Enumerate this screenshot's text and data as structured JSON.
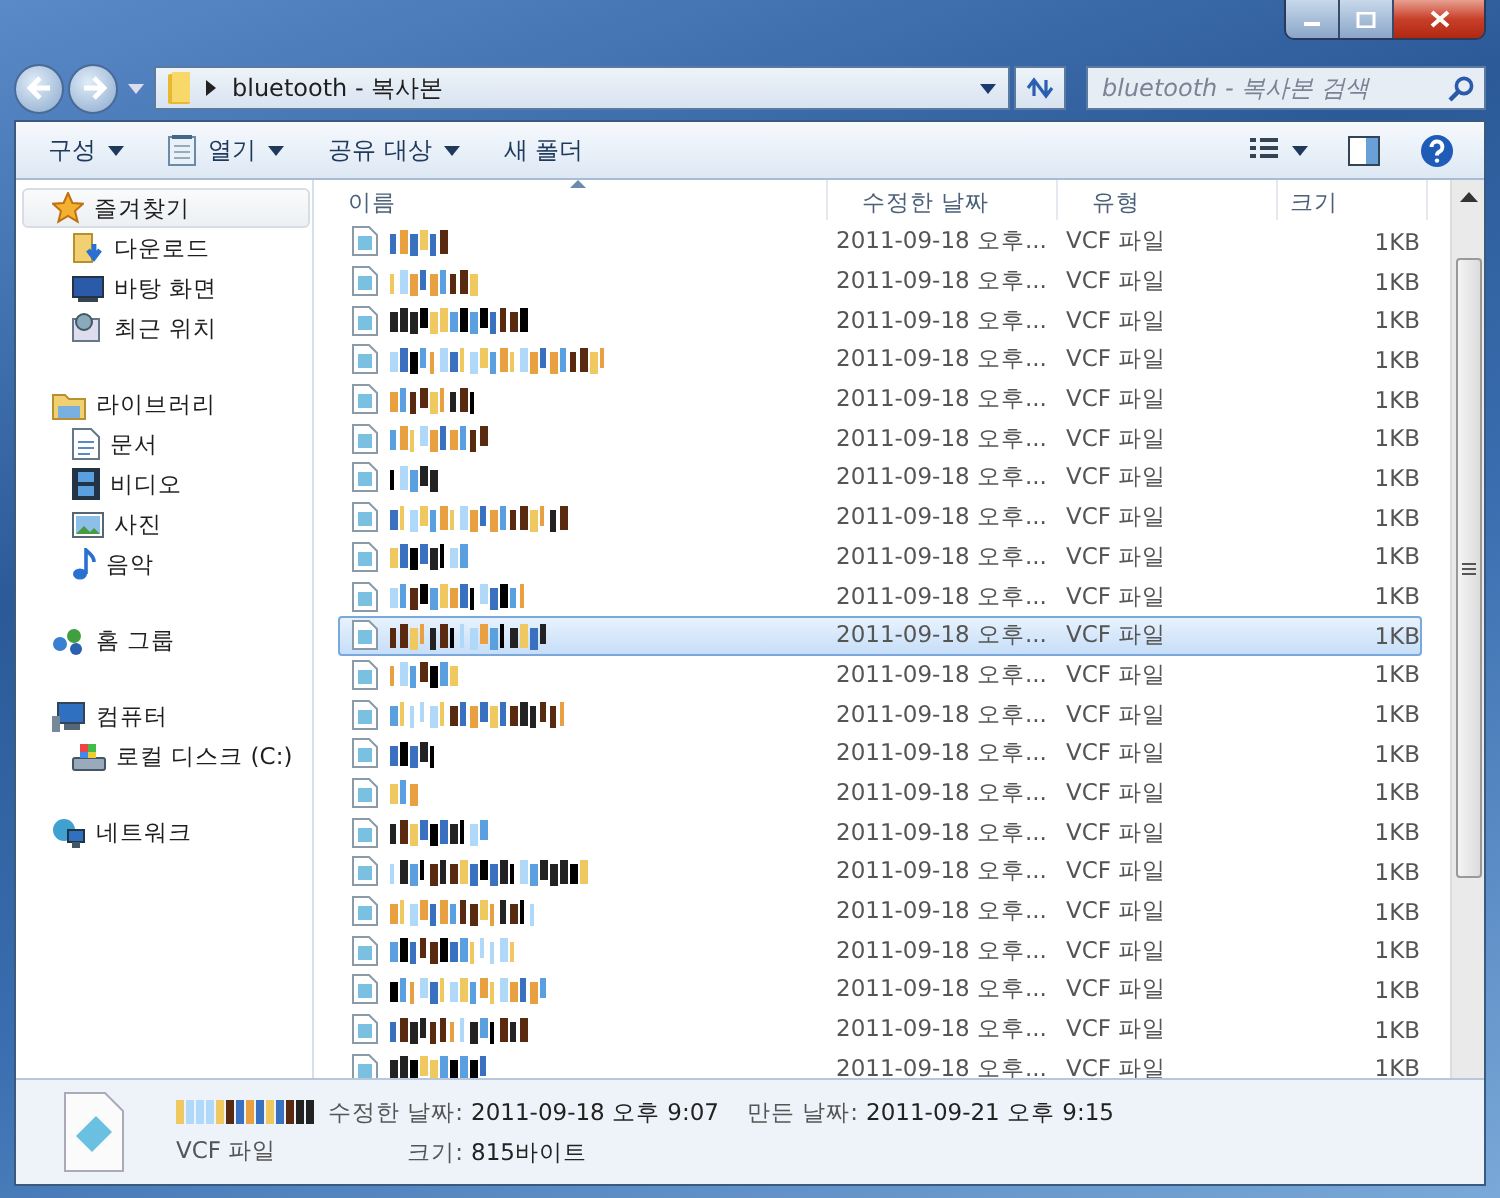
{
  "address": {
    "path": "bluetooth - 복사본"
  },
  "search": {
    "placeholder": "bluetooth - 복사본 검색"
  },
  "toolbar": [
    {
      "label": "구성",
      "dropdown": true
    },
    {
      "label": "열기",
      "dropdown": true
    },
    {
      "label": "공유 대상",
      "dropdown": true
    },
    {
      "label": "새 폴더",
      "dropdown": false
    }
  ],
  "sidebar": {
    "groups": [
      {
        "label": "즐겨찾기",
        "selected": true,
        "children": [
          {
            "label": "다운로드",
            "selected": false
          },
          {
            "label": "바탕 화면",
            "selected": false
          },
          {
            "label": "최근 위치",
            "selected": false
          }
        ]
      },
      {
        "label": "라이브러리",
        "selected": false,
        "children": [
          {
            "label": "문서",
            "selected": false
          },
          {
            "label": "비디오",
            "selected": false
          },
          {
            "label": "사진",
            "selected": false
          },
          {
            "label": "음악",
            "selected": false
          }
        ]
      },
      {
        "label": "홈 그룹",
        "selected": false
      },
      {
        "label": "컴퓨터",
        "selected": false,
        "children": [
          {
            "label": "로컬 디스크 (C:)",
            "selected": false
          }
        ]
      },
      {
        "label": "네트워크",
        "selected": false
      }
    ]
  },
  "columns": [
    {
      "label": "이름",
      "sorted": true
    },
    {
      "label": "수정한 날짜",
      "sorted": false
    },
    {
      "label": "유형",
      "sorted": false
    },
    {
      "label": "크기",
      "sorted": false
    }
  ],
  "rows": [
    {
      "modified": "2011-09-18 오후...",
      "type": "VCF 파일",
      "size": "1KB",
      "selected": false
    },
    {
      "modified": "2011-09-18 오후...",
      "type": "VCF 파일",
      "size": "1KB",
      "selected": false
    },
    {
      "modified": "2011-09-18 오후...",
      "type": "VCF 파일",
      "size": "1KB",
      "selected": false
    },
    {
      "modified": "2011-09-18 오후...",
      "type": "VCF 파일",
      "size": "1KB",
      "selected": false
    },
    {
      "modified": "2011-09-18 오후...",
      "type": "VCF 파일",
      "size": "1KB",
      "selected": false
    },
    {
      "modified": "2011-09-18 오후...",
      "type": "VCF 파일",
      "size": "1KB",
      "selected": false
    },
    {
      "modified": "2011-09-18 오후...",
      "type": "VCF 파일",
      "size": "1KB",
      "selected": false
    },
    {
      "modified": "2011-09-18 오후...",
      "type": "VCF 파일",
      "size": "1KB",
      "selected": false
    },
    {
      "modified": "2011-09-18 오후...",
      "type": "VCF 파일",
      "size": "1KB",
      "selected": false
    },
    {
      "modified": "2011-09-18 오후...",
      "type": "VCF 파일",
      "size": "1KB",
      "selected": false
    },
    {
      "modified": "2011-09-18 오후...",
      "type": "VCF 파일",
      "size": "1KB",
      "selected": true
    },
    {
      "modified": "2011-09-18 오후...",
      "type": "VCF 파일",
      "size": "1KB",
      "selected": false
    },
    {
      "modified": "2011-09-18 오후...",
      "type": "VCF 파일",
      "size": "1KB",
      "selected": false
    },
    {
      "modified": "2011-09-18 오후...",
      "type": "VCF 파일",
      "size": "1KB",
      "selected": false
    },
    {
      "modified": "2011-09-18 오후...",
      "type": "VCF 파일",
      "size": "1KB",
      "selected": false
    },
    {
      "modified": "2011-09-18 오후...",
      "type": "VCF 파일",
      "size": "1KB",
      "selected": false
    },
    {
      "modified": "2011-09-18 오후...",
      "type": "VCF 파일",
      "size": "1KB",
      "selected": false
    },
    {
      "modified": "2011-09-18 오후...",
      "type": "VCF 파일",
      "size": "1KB",
      "selected": false
    },
    {
      "modified": "2011-09-18 오후...",
      "type": "VCF 파일",
      "size": "1KB",
      "selected": false
    },
    {
      "modified": "2011-09-18 오후...",
      "type": "VCF 파일",
      "size": "1KB",
      "selected": false
    },
    {
      "modified": "2011-09-18 오후...",
      "type": "VCF 파일",
      "size": "1KB",
      "selected": false
    },
    {
      "modified": "2011-09-18 오후...",
      "type": "VCF 파일",
      "size": "1KB",
      "selected": false
    }
  ],
  "details": {
    "type": "VCF 파일",
    "modified_label": "수정한 날짜:",
    "modified": "2011-09-18 오후 9:07",
    "created_label": "만든 날짜:",
    "created": "2011-09-21 오후 9:15",
    "size_label": "크기:",
    "size": "815바이트"
  }
}
